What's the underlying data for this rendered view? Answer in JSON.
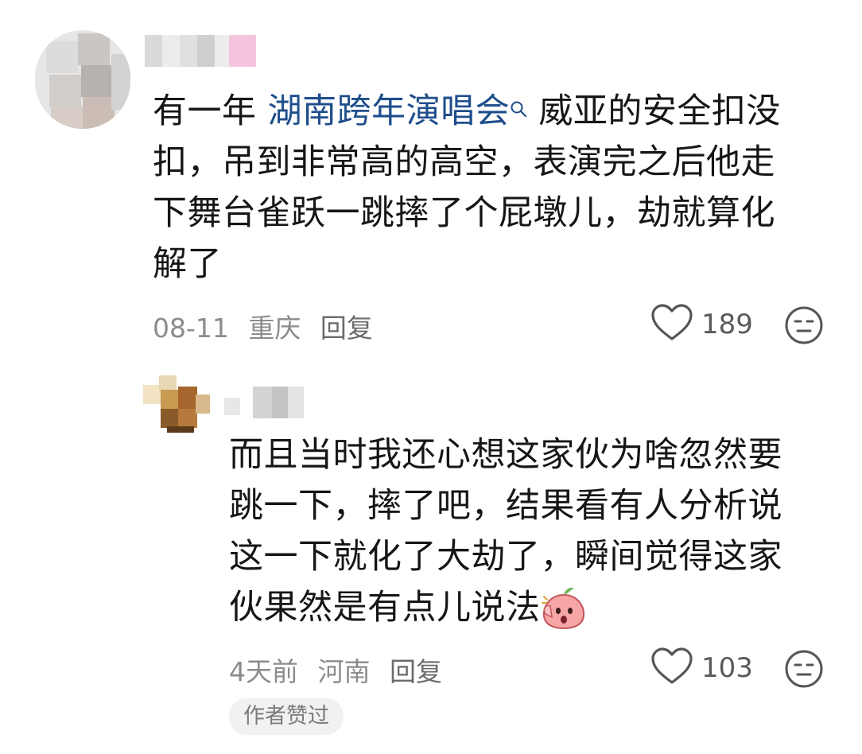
{
  "comment1": {
    "content_lines": [
      "有一年",
      "湖南跨年演唱会",
      "威亚的安全扣没",
      "扣，吊到非常高的高空，表演完之后他走",
      "下舞台雀跃一跳摔了个屁墩儿，劫就算化",
      "解了"
    ],
    "link_icon": "search-icon",
    "date": "08-11",
    "location": "重庆",
    "reply_label": "回复",
    "like_count": "189"
  },
  "comment2": {
    "content_lines": [
      "而且当时我还心想这家伙为啥忽然要",
      "跳一下，摔了吧，结果看有人分析说",
      "这一下就化了大劫了，瞬间觉得这家",
      "伙果然是有点儿说法"
    ],
    "emoji": "peach-shocked-emoji",
    "date": "4天前",
    "location": "河南",
    "reply_label": "回复",
    "like_count": "103",
    "badge": "作者赞过"
  },
  "colors": {
    "link": "#1f4e8c",
    "meta": "#8c8c8c",
    "badge_bg": "#f1f1f1"
  }
}
